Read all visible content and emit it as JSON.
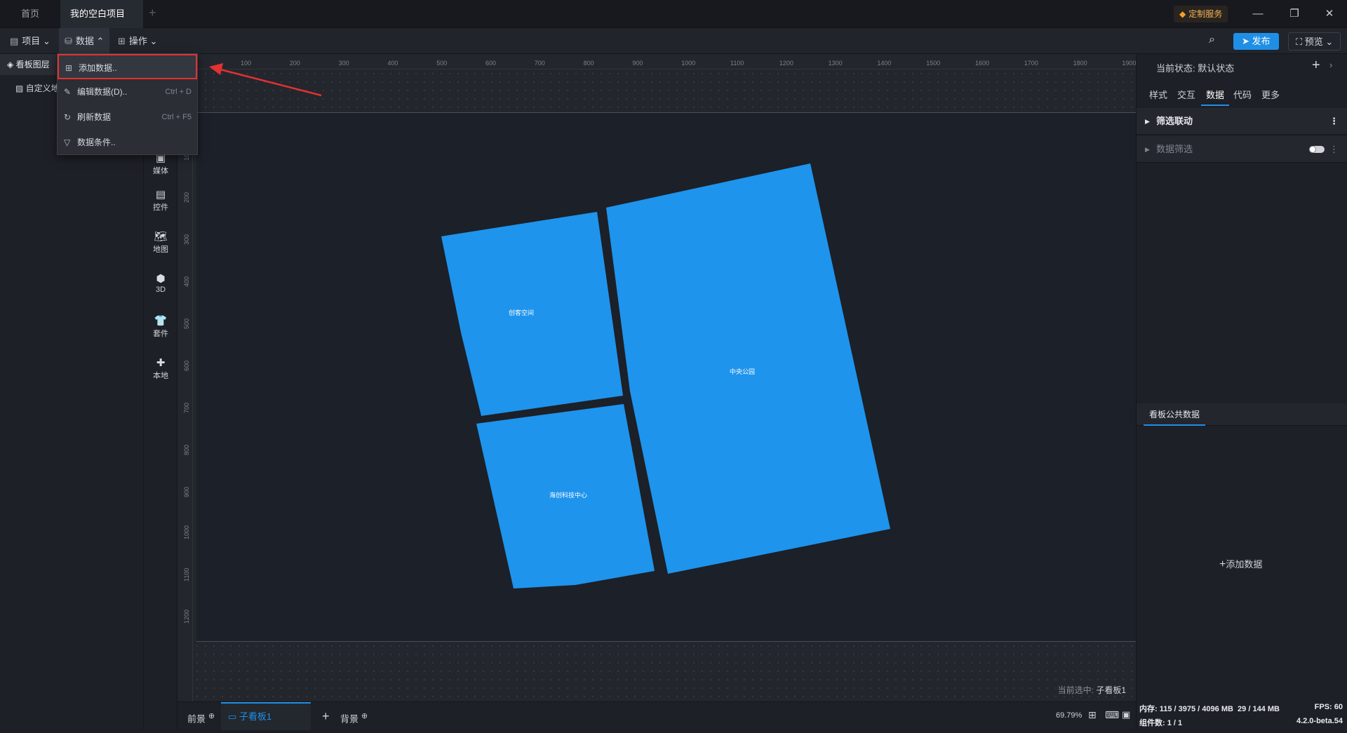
{
  "tabs": [
    {
      "label": "首页"
    },
    {
      "label": "我的空白项目"
    }
  ],
  "custom_service": "定制服务",
  "toolbar": {
    "project": "项目",
    "data": "数据",
    "operate": "操作",
    "publish": "发布",
    "preview": "预览"
  },
  "dropdown": {
    "items": [
      {
        "label": "添加数据..",
        "shortcut": ""
      },
      {
        "label": "编辑数据(D)..",
        "shortcut": "Ctrl + D"
      },
      {
        "label": "刷新数据",
        "shortcut": "Ctrl + F5"
      },
      {
        "label": "数据条件..",
        "shortcut": ""
      }
    ]
  },
  "left_panel": {
    "title": "看板图层",
    "layer": "自定义地"
  },
  "left_icons": [
    "媒体",
    "控件",
    "地图",
    "3D",
    "套件",
    "本地"
  ],
  "ruler": {
    "h": [
      "100",
      "200",
      "300",
      "400",
      "500",
      "600",
      "700",
      "800",
      "900",
      "1000",
      "1100",
      "1200",
      "1300",
      "1400",
      "1500",
      "1600",
      "1700",
      "1800",
      "1900"
    ],
    "v": [
      "100",
      "200",
      "300",
      "400",
      "500",
      "600",
      "700",
      "800",
      "900",
      "1000",
      "1100",
      "1200"
    ]
  },
  "map_regions": [
    {
      "name": "创客空间"
    },
    {
      "name": "中央公园"
    },
    {
      "name": "海创科技中心"
    }
  ],
  "current_selection": {
    "prefix": "当前选中:",
    "value": "子看板1"
  },
  "bottom": {
    "front": "前景",
    "sub_board": "子看板1",
    "background": "背景",
    "zoom": "69.79%"
  },
  "right_panel": {
    "state_label": "当前状态:",
    "state_value": "默认状态",
    "tabs": [
      "样式",
      "交互",
      "数据",
      "代码",
      "更多"
    ],
    "active_tab": "数据",
    "filter_link": "筛选联动",
    "data_filter": "数据筛选",
    "public_data": "看板公共数据",
    "add_data": "添加数据"
  },
  "status_bar": {
    "memory_label": "内存:",
    "memory_value": "115 / 3975 / 4096 MB",
    "mem2": "29 / 144 MB",
    "fps": "FPS:  60",
    "components": "组件数: 1 / 1",
    "version": "4.2.0-beta.54"
  },
  "colors": {
    "accent": "#1f8fe6",
    "region_fill": "#1e94ed",
    "highlight_border": "#e33131"
  }
}
